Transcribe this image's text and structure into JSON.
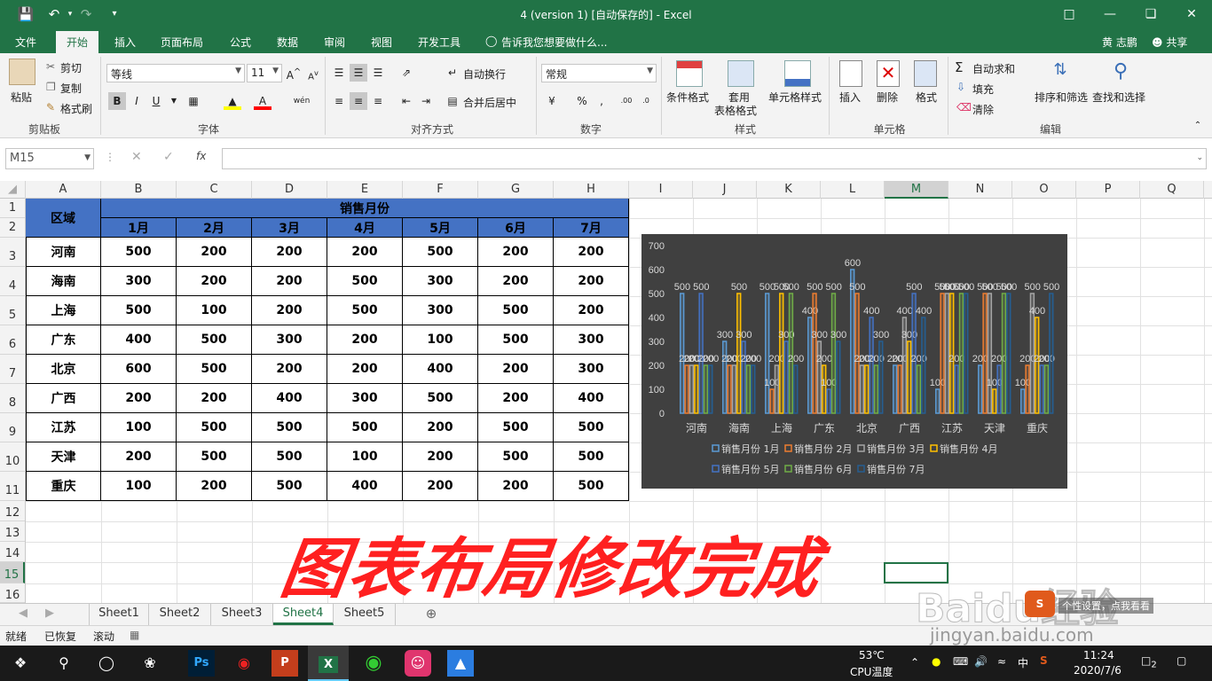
{
  "window": {
    "title": "4 (version 1) [自动保存的] - Excel",
    "user": "黄 志鹏",
    "share": "共享"
  },
  "menu_tabs": [
    "文件",
    "开始",
    "插入",
    "页面布局",
    "公式",
    "数据",
    "审阅",
    "视图",
    "开发工具"
  ],
  "tell_me": "告诉我您想要做什么...",
  "ribbon": {
    "clipboard": {
      "paste": "粘贴",
      "cut": "剪切",
      "copy": "复制",
      "format_painter": "格式刷",
      "label": "剪贴板"
    },
    "font": {
      "name": "等线",
      "size": "11",
      "bold": "B",
      "italic": "I",
      "underline": "U",
      "label": "字体"
    },
    "align": {
      "wrap": "自动换行",
      "merge": "合并后居中",
      "label": "对齐方式"
    },
    "number": {
      "format": "常规",
      "percent": "%",
      "comma": ",",
      "label": "数字"
    },
    "styles": {
      "cond": "条件格式",
      "table_fmt_1": "套用",
      "table_fmt_2": "表格格式",
      "cell_style": "单元格样式",
      "label": "样式"
    },
    "cells": {
      "insert": "插入",
      "delete": "删除",
      "format": "格式",
      "label": "单元格"
    },
    "editing": {
      "autosum": "自动求和",
      "fill": "填充",
      "clear": "清除",
      "sort": "排序和筛选",
      "find": "查找和选择",
      "label": "编辑"
    }
  },
  "formula_bar": {
    "name_box": "M15",
    "fx": "fx",
    "value": ""
  },
  "columns": [
    "A",
    "B",
    "C",
    "D",
    "E",
    "F",
    "G",
    "H",
    "I",
    "J",
    "K",
    "L",
    "M",
    "N",
    "O",
    "P",
    "Q"
  ],
  "rows": [
    "1",
    "2",
    "3",
    "4",
    "5",
    "6",
    "7",
    "8",
    "9",
    "10",
    "11",
    "12",
    "13",
    "14",
    "15",
    "16"
  ],
  "table": {
    "region_header": "区域",
    "group_header": "销售月份",
    "months": [
      "1月",
      "2月",
      "3月",
      "4月",
      "5月",
      "6月",
      "7月"
    ],
    "data": [
      {
        "region": "河南",
        "v": [
          "500",
          "200",
          "200",
          "200",
          "500",
          "200",
          "200"
        ]
      },
      {
        "region": "海南",
        "v": [
          "300",
          "200",
          "200",
          "500",
          "300",
          "200",
          "200"
        ]
      },
      {
        "region": "上海",
        "v": [
          "500",
          "100",
          "200",
          "500",
          "300",
          "500",
          "200"
        ]
      },
      {
        "region": "广东",
        "v": [
          "400",
          "500",
          "300",
          "200",
          "100",
          "500",
          "300"
        ]
      },
      {
        "region": "北京",
        "v": [
          "600",
          "500",
          "200",
          "200",
          "400",
          "200",
          "300"
        ]
      },
      {
        "region": "广西",
        "v": [
          "200",
          "200",
          "400",
          "300",
          "500",
          "200",
          "400"
        ]
      },
      {
        "region": "江苏",
        "v": [
          "100",
          "500",
          "500",
          "500",
          "200",
          "500",
          "500"
        ]
      },
      {
        "region": "天津",
        "v": [
          "200",
          "500",
          "500",
          "100",
          "200",
          "500",
          "500"
        ]
      },
      {
        "region": "重庆",
        "v": [
          "100",
          "200",
          "500",
          "400",
          "200",
          "200",
          "500"
        ]
      }
    ]
  },
  "chart_data": {
    "type": "bar",
    "categories": [
      "河南",
      "海南",
      "上海",
      "广东",
      "北京",
      "广西",
      "江苏",
      "天津",
      "重庆"
    ],
    "series": [
      {
        "name": "销售月份 1月",
        "values": [
          500,
          300,
          500,
          400,
          600,
          200,
          100,
          200,
          100
        ],
        "color": "#5b9bd5"
      },
      {
        "name": "销售月份 2月",
        "values": [
          200,
          200,
          100,
          500,
          500,
          200,
          500,
          500,
          200
        ],
        "color": "#ed7d31"
      },
      {
        "name": "销售月份 3月",
        "values": [
          200,
          200,
          200,
          300,
          200,
          400,
          500,
          500,
          500
        ],
        "color": "#a5a5a5"
      },
      {
        "name": "销售月份 4月",
        "values": [
          200,
          500,
          500,
          200,
          200,
          300,
          500,
          100,
          400
        ],
        "color": "#ffc000"
      },
      {
        "name": "销售月份 5月",
        "values": [
          500,
          300,
          300,
          100,
          400,
          500,
          200,
          200,
          200
        ],
        "color": "#4472c4"
      },
      {
        "name": "销售月份 6月",
        "values": [
          200,
          200,
          500,
          500,
          200,
          200,
          500,
          500,
          200
        ],
        "color": "#70ad47"
      },
      {
        "name": "销售月份 7月",
        "values": [
          200,
          200,
          200,
          300,
          300,
          400,
          500,
          500,
          500
        ],
        "color": "#255e91"
      }
    ],
    "yticks": [
      "0",
      "100",
      "200",
      "300",
      "400",
      "500",
      "600",
      "700"
    ],
    "ylim": [
      0,
      700
    ],
    "legend_position": "bottom",
    "grid": false
  },
  "overlay_text": "图表布局修改完成",
  "sheets": [
    "Sheet1",
    "Sheet2",
    "Sheet3",
    "Sheet4",
    "Sheet5"
  ],
  "active_sheet": "Sheet4",
  "status": {
    "ready": "就绪",
    "recovered": "已恢复",
    "scroll": "滚动"
  },
  "watermark": {
    "brand": "Baidu经验",
    "url": "jingyan.baidu.com",
    "tip": "个性设置，点我看看"
  },
  "taskbar": {
    "temp": "53℃",
    "temp_label": "CPU温度",
    "lang": "中",
    "time": "11:24",
    "date": "2020/7/6",
    "notif": "2"
  }
}
